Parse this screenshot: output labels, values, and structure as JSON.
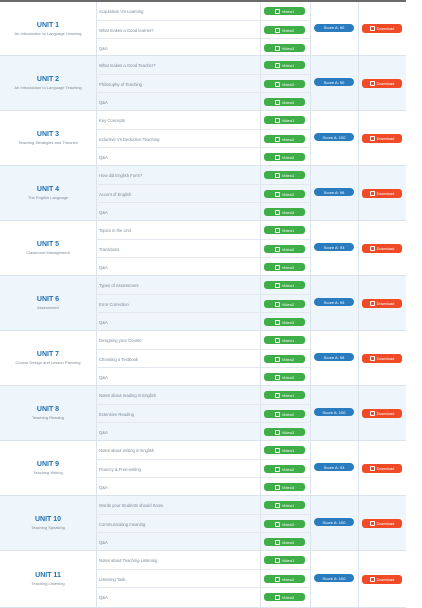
{
  "units": [
    {
      "title": "UNIT 1",
      "subtitle": "An Introduction to Language Learning",
      "lessons": [
        "Acquisition VS Learning",
        "What makes a Good learner?",
        "Q&A"
      ],
      "videos": [
        "Video1",
        "Video2",
        "Video3"
      ],
      "score": "Score A: 90",
      "download": "Download"
    },
    {
      "title": "UNIT 2",
      "subtitle": "An Introduction to Language Teaching",
      "lessons": [
        "What makes a Good Teacher?",
        "Philosophy of Teaching",
        "Q&A"
      ],
      "videos": [
        "Video1",
        "Video2",
        "Video3"
      ],
      "score": "Score A: 90",
      "download": "Download"
    },
    {
      "title": "UNIT 3",
      "subtitle": "Teaching Strategies and Theories",
      "lessons": [
        "Key Concepts",
        "Inductive Vs Deductive Teaching",
        "Q&A"
      ],
      "videos": [
        "Video1",
        "Video2",
        "Video3"
      ],
      "score": "Score A: 100",
      "download": "Download"
    },
    {
      "title": "UNIT 4",
      "subtitle": "The English Language",
      "lessons": [
        "How did English Form?",
        "Accent of English",
        "Q&A"
      ],
      "videos": [
        "Video1",
        "Video2",
        "Video3"
      ],
      "score": "Score A: 96",
      "download": "Download"
    },
    {
      "title": "UNIT 5",
      "subtitle": "Classroom Management",
      "lessons": [
        "Topics in the Unit",
        "Transitions",
        "Q&A"
      ],
      "videos": [
        "Video1",
        "Video2",
        "Video3"
      ],
      "score": "Score A: 93",
      "download": "Download"
    },
    {
      "title": "UNIT 6",
      "subtitle": "Assessment",
      "lessons": [
        "Types of Assessment",
        "Error Correction",
        "Q&A"
      ],
      "videos": [
        "Video1",
        "Video2",
        "Video3"
      ],
      "score": "Score A: 95",
      "download": "Download"
    },
    {
      "title": "UNIT 7",
      "subtitle": "Course Design and Lesson Planning",
      "lessons": [
        "Designing your Course",
        "Choosing a Textbook",
        "Q&A"
      ],
      "videos": [
        "Video1",
        "Video2",
        "Video3"
      ],
      "score": "Score A: 98",
      "download": "Download"
    },
    {
      "title": "UNIT 8",
      "subtitle": "Teaching Reading",
      "lessons": [
        "Notes about reading in English",
        "Extensive Reading",
        "Q&A"
      ],
      "videos": [
        "Video1",
        "Video2",
        "Video3"
      ],
      "score": "Score A: 100",
      "download": "Download"
    },
    {
      "title": "UNIT 9",
      "subtitle": "Teaching Writing",
      "lessons": [
        "Notes about writing in English",
        "Fluency & Free-writing",
        "Q&A"
      ],
      "videos": [
        "Video1",
        "Video2",
        "Video3"
      ],
      "score": "Score A: 93",
      "download": "Download"
    },
    {
      "title": "UNIT 10",
      "subtitle": "Teaching Speaking",
      "lessons": [
        "Words your Students should Know",
        "Communicating meaning",
        "Q&A"
      ],
      "videos": [
        "Video1",
        "Video2",
        "Video3"
      ],
      "score": "Score A: 100",
      "download": "Download"
    },
    {
      "title": "UNIT 11",
      "subtitle": "Teaching Listening",
      "lessons": [
        "Notes about Teaching Listening",
        "Listening Task",
        "Q&A"
      ],
      "videos": [
        "Video1",
        "Video2",
        "Video3"
      ],
      "score": "Score A: 100",
      "download": "Download"
    }
  ],
  "colors": {
    "unit_title": "#1f6fae",
    "video_button": "#3fae49",
    "score_badge": "#2a7cbf",
    "download_button": "#f04a26",
    "alt_row": "#eef5fb"
  },
  "icons": {
    "video": "play-icon",
    "download": "download-icon"
  }
}
